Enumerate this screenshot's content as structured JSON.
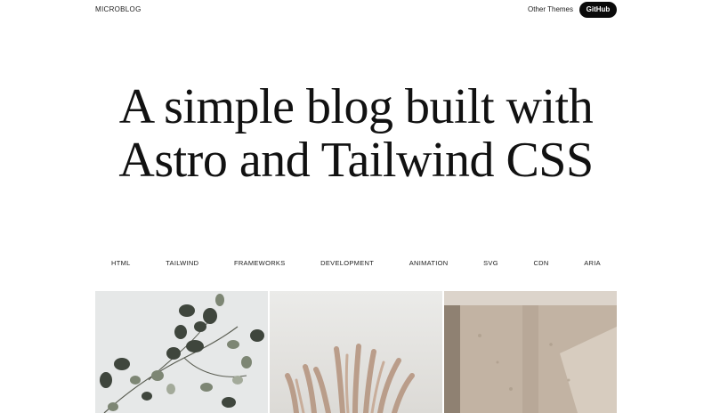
{
  "header": {
    "brand": "MICROBLOG",
    "other_themes": "Other Themes",
    "github": "GitHub"
  },
  "hero": {
    "line1": "A simple blog built with",
    "line2": "Astro and Tailwind CSS"
  },
  "tags": [
    "HTML",
    "TAILWIND",
    "FRAMEWORKS",
    "DEVELOPMENT",
    "ANIMATION",
    "SVG",
    "CDN",
    "ARIA"
  ],
  "gallery": [
    {
      "name": "eucalyptus-image"
    },
    {
      "name": "pampas-grass-image"
    },
    {
      "name": "concrete-wall-image"
    }
  ]
}
